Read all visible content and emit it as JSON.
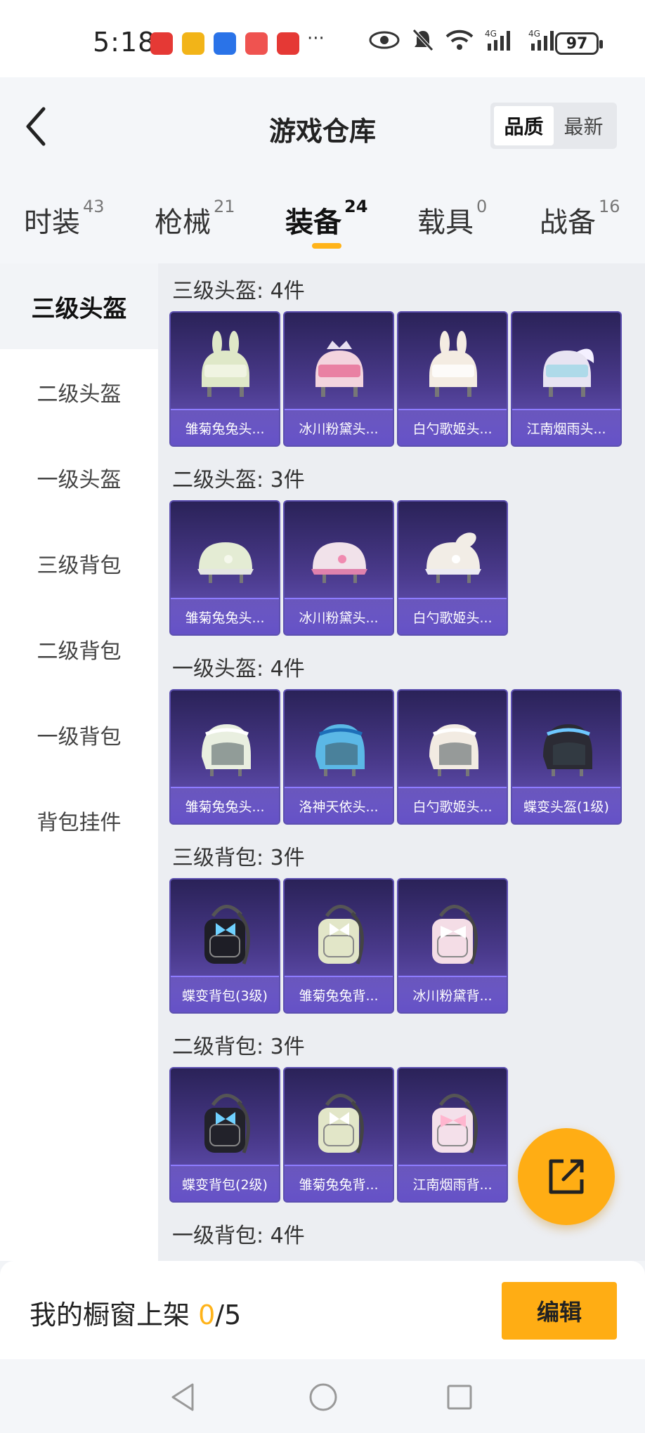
{
  "status_bar": {
    "time": "5:18",
    "notification_icons": [
      "huawei-store-icon",
      "app-icon",
      "bulb-icon",
      "book-icon",
      "huawei-app-icon"
    ],
    "more": "···",
    "battery": "97"
  },
  "header": {
    "title": "游戏仓库",
    "sort_options": [
      "品质",
      "最新"
    ],
    "sort_active": "品质"
  },
  "tabs": [
    {
      "label": "时装",
      "count": "43"
    },
    {
      "label": "枪械",
      "count": "21"
    },
    {
      "label": "装备",
      "count": "24"
    },
    {
      "label": "载具",
      "count": "0"
    },
    {
      "label": "战备",
      "count": "16"
    }
  ],
  "active_tab": "装备",
  "sidebar": {
    "items": [
      "三级头盔",
      "二级头盔",
      "一级头盔",
      "三级背包",
      "二级背包",
      "一级背包",
      "背包挂件"
    ]
  },
  "sections": [
    {
      "title": "三级头盔: 4件",
      "items": [
        {
          "name": "雏菊兔兔头...",
          "art": "helmet-rabbit-lv3"
        },
        {
          "name": "冰川粉黛头...",
          "art": "helmet-pink-lv3"
        },
        {
          "name": "白勺歌姬头...",
          "art": "helmet-white-lv3"
        },
        {
          "name": "江南烟雨头...",
          "art": "helmet-blue-lv3"
        }
      ]
    },
    {
      "title": "二级头盔: 3件",
      "items": [
        {
          "name": "雏菊兔兔头...",
          "art": "helmet-green-lv2"
        },
        {
          "name": "冰川粉黛头...",
          "art": "helmet-pink-lv2"
        },
        {
          "name": "白勺歌姬头...",
          "art": "helmet-white-lv2"
        }
      ]
    },
    {
      "title": "一级头盔: 4件",
      "items": [
        {
          "name": "雏菊兔兔头...",
          "art": "helmet-green-lv1"
        },
        {
          "name": "洛神天依头...",
          "art": "helmet-blue-lv1"
        },
        {
          "name": "白勺歌姬头...",
          "art": "helmet-white-lv1"
        },
        {
          "name": "蝶变头盔(1级)",
          "art": "helmet-black-lv1"
        }
      ]
    },
    {
      "title": "三级背包: 3件",
      "items": [
        {
          "name": "蝶变背包(3级)",
          "art": "backpack-black-lv3"
        },
        {
          "name": "雏菊兔兔背...",
          "art": "backpack-green-lv3"
        },
        {
          "name": "冰川粉黛背...",
          "art": "backpack-pink-lv3"
        }
      ]
    },
    {
      "title": "二级背包: 3件",
      "items": [
        {
          "name": "蝶变背包(2级)",
          "art": "backpack-black-lv2"
        },
        {
          "name": "雏菊兔兔背...",
          "art": "backpack-green-lv2"
        },
        {
          "name": "江南烟雨背...",
          "art": "backpack-pink-lv2"
        }
      ]
    },
    {
      "title": "一级背包: 4件",
      "items": []
    }
  ],
  "bottom": {
    "window_label": "我的橱窗上架 ",
    "current": "0",
    "total": "/5",
    "edit_label": "编辑"
  },
  "colors": {
    "accent": "#ffad14",
    "card_top": "#2a2258",
    "card_bottom": "#6a58bf"
  }
}
